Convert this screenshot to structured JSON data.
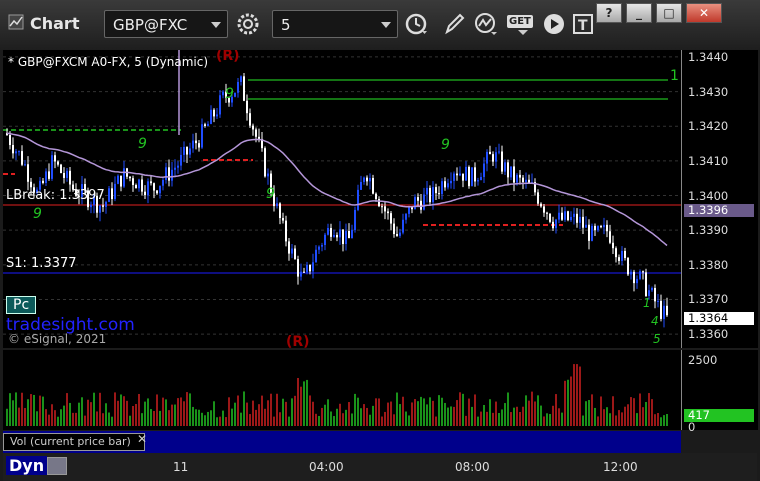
{
  "window": {
    "app_title": "Chart",
    "symbol": "GBP@FXC",
    "interval": "5",
    "buttons": {
      "help": "?",
      "minimize": "_",
      "maximize": "□",
      "close": "✕"
    },
    "toolbar_icons": [
      "settings-gear-icon",
      "clock-icon",
      "pencil-icon",
      "study-chart-icon",
      "get-icon",
      "play-icon",
      "text-tool-icon"
    ],
    "get_label": "GET"
  },
  "chart": {
    "header": "* GBP@FXCM A0-FX, 5 (Dynamic)",
    "lbreak_label": "LBreak: 1.3397",
    "s1_label": "S1: 1.3377",
    "watermark": "tradesight.com",
    "copyright": "© eSignal, 2021",
    "pc_label": "Pc",
    "r_markers": [
      "(R)",
      "(R)"
    ],
    "count_labels": [
      "9",
      "9",
      "9",
      "9",
      "9",
      "1",
      "2",
      "3",
      "4",
      "5",
      "1"
    ],
    "colors": {
      "up": "#1f4dff",
      "down": "#ffffff",
      "ma": "#b496d8",
      "resistance": "#1a9a1a",
      "red_line": "#e02020",
      "blue_line": "#1c1cff",
      "setup": "#22c322"
    }
  },
  "price_axis": {
    "ticks": [
      "1.3440",
      "1.3430",
      "1.3420",
      "1.3410",
      "1.3400",
      "1.3390",
      "1.3380",
      "1.3370",
      "1.3360"
    ],
    "ma_tag": "1.3396",
    "last_tag": "1.3364"
  },
  "volume": {
    "label": "Vol (current price bar)",
    "close_x": "✕",
    "ticks": [
      "2500",
      "0"
    ],
    "last_tag": "417"
  },
  "time_axis": {
    "label": "Dyn",
    "ticks": [
      "11",
      "04:00",
      "08:00",
      "12:00"
    ]
  },
  "chart_data": {
    "type": "candlestick",
    "x": [
      "11",
      "04:00",
      "08:00",
      "12:00"
    ],
    "ylim": [
      1.3356,
      1.3442
    ],
    "levels": [
      {
        "name": "LBreak",
        "value": 1.3397
      },
      {
        "name": "S1",
        "value": 1.3377
      }
    ],
    "last_price": 1.3364,
    "ma_last": 1.3396,
    "volume_last": 417,
    "volume_ylim": [
      0,
      2500
    ]
  }
}
